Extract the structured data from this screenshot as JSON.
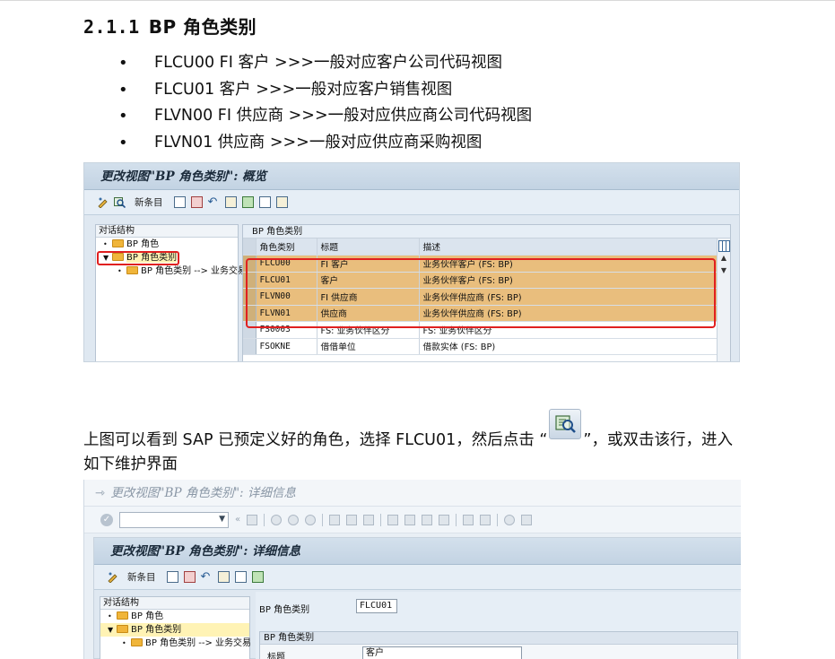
{
  "heading": {
    "number": "2.1.1",
    "title": "BP 角色类别"
  },
  "bullets": [
    "FLCU00 FI 客户  >>>一般对应客户公司代码视图",
    "FLCU01  客户  >>>一般对应客户销售视图",
    "FLVN00 FI 供应商  >>>一般对应供应商公司代码视图",
    "FLVN01  供应商  >>>一般对应供应商采购视图"
  ],
  "screen1": {
    "title": "更改视图\"BP 角色类别\": 概览",
    "toolbar_new": "新条目",
    "dialog_header": "对话结构",
    "tree": [
      "BP 角色",
      "BP 角色类别",
      "BP 角色类别 --> 业务交易"
    ],
    "grid_caption": "BP 角色类别",
    "columns": [
      "角色类别",
      "标题",
      "描述"
    ],
    "rows": [
      [
        "FLCU00",
        "FI 客户",
        "业务伙伴客户 (FS: BP)"
      ],
      [
        "FLCU01",
        "客户",
        "业务伙伴客户 (FS: BP)"
      ],
      [
        "FLVN00",
        "FI 供应商",
        "业务伙伴供应商 (FS: BP)"
      ],
      [
        "FLVN01",
        "供应商",
        "业务伙伴供应商 (FS: BP)"
      ],
      [
        "FS0003",
        "FS: 业务伙伴区分",
        "FS: 业务伙伴区分"
      ],
      [
        "FSOKNE",
        "借借单位",
        "借款实体 (FS: BP)"
      ]
    ],
    "highlight_color": "#e9be7d",
    "frame_color": "#e02020"
  },
  "para1_before": "上图可以看到 SAP 已预定义好的角色，选择 FLCU01，然后点击 “",
  "para1_after": "”，或双击该行，进入",
  "para2": "如下维护界面",
  "screen2": {
    "window_title": "更改视图\"BP 角色类别\": 详细信息",
    "title": "更改视图\"BP 角色类别\": 详细信息",
    "toolbar_new": "新条目",
    "dialog_header": "对话结构",
    "tree": [
      "BP 角色",
      "BP 角色类别",
      "BP 角色类别 --> 业务交易"
    ],
    "field_label": "BP 角色类别",
    "field_value": "FLCU01",
    "group_header": "BP 角色类别",
    "group_label": "标题",
    "group_value": "客户"
  }
}
